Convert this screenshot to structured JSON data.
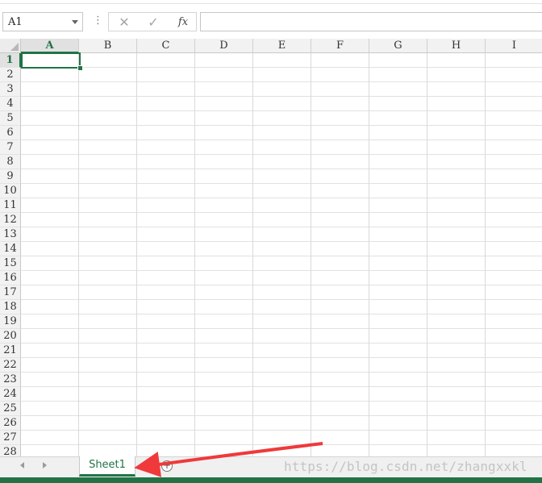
{
  "formula_bar": {
    "name_box_value": "A1",
    "dots_label": "⋮",
    "cancel_icon": "✕",
    "enter_icon": "✓",
    "function_icon": "fx",
    "formula_value": ""
  },
  "columns": [
    "A",
    "B",
    "C",
    "D",
    "E",
    "F",
    "G",
    "H",
    "I"
  ],
  "rows": [
    "1",
    "2",
    "3",
    "4",
    "5",
    "6",
    "7",
    "8",
    "9",
    "10",
    "11",
    "12",
    "13",
    "14",
    "15",
    "16",
    "17",
    "18",
    "19",
    "20",
    "21",
    "22",
    "23",
    "24",
    "25",
    "26",
    "27",
    "28"
  ],
  "selection": {
    "column": "A",
    "row": "1"
  },
  "sheet_tabs": {
    "active_tab_label": "Sheet1",
    "new_sheet_icon": "+"
  },
  "watermark": "https://blog.csdn.net/zhangxxkl",
  "colors": {
    "accent": "#217346",
    "annotation_arrow": "#f0393b"
  },
  "icons": {
    "name_box_dropdown": "chevron-down-icon",
    "cancel": "close-icon",
    "enter": "check-icon",
    "function": "function-icon",
    "nav_left": "caret-left-icon",
    "nav_right": "caret-right-icon",
    "new_sheet": "plus-circle-icon",
    "annotation": "arrow-icon"
  }
}
